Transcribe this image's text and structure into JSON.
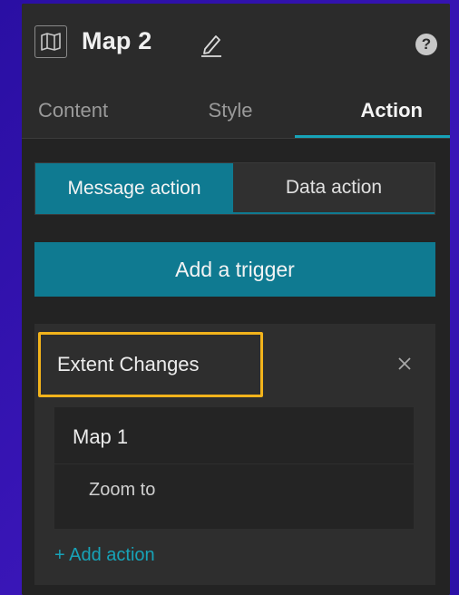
{
  "header": {
    "title": "Map 2",
    "map_icon": "map-icon",
    "edit_icon": "pencil-icon",
    "help_label": "?"
  },
  "tabs": [
    {
      "label": "Content",
      "active": false
    },
    {
      "label": "Style",
      "active": false
    },
    {
      "label": "Action",
      "active": true
    }
  ],
  "segmented": {
    "message_action": "Message action",
    "data_action": "Data action",
    "selected": "Message action"
  },
  "add_trigger_label": "Add a trigger",
  "trigger_card": {
    "event": "Extent Changes",
    "close_icon": "close-icon",
    "action": {
      "target": "Map 1",
      "name": "Zoom to"
    },
    "add_action_label": "+ Add action"
  },
  "colors": {
    "accent": "#0f7a91",
    "highlight": "#f2b31b",
    "background": "#2a0fa3"
  }
}
